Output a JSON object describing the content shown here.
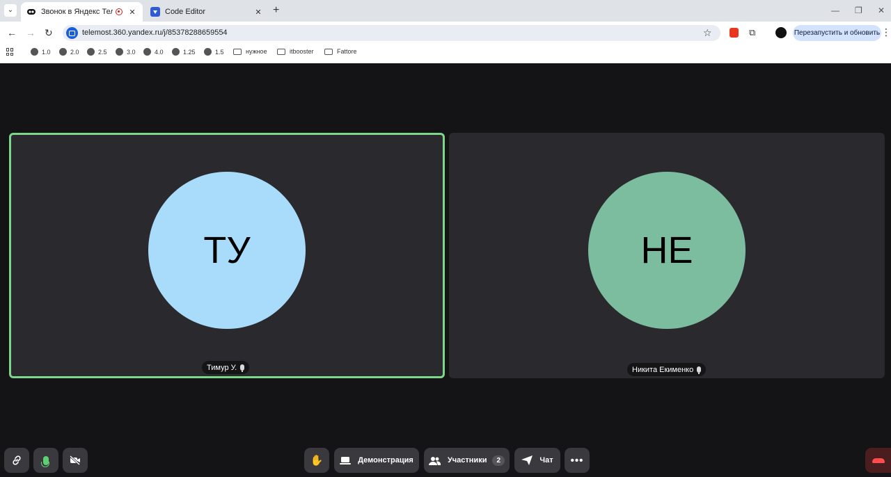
{
  "browser": {
    "tabs": [
      {
        "title": "Звонок в Яндекс Телемост",
        "close": "✕"
      },
      {
        "title": "Code Editor",
        "close": "✕"
      }
    ],
    "new_tab": "+",
    "url": "telemost.360.yandex.ru/j/85378288659554",
    "relaunch_label": "Перезапустить и обновить",
    "bookmarks": [
      "1.0",
      "2.0",
      "2.5",
      "3.0",
      "4.0",
      "1.25",
      "1.5",
      "нужное",
      "itbooster",
      "Fattore"
    ]
  },
  "call": {
    "participants": [
      {
        "initials": "ТУ",
        "name": "Тимур У.",
        "avatar_color": "#a8dcfa"
      },
      {
        "initials": "НЕ",
        "name": "Никита Екименко",
        "avatar_color": "#7cbda0"
      }
    ],
    "controls": {
      "demo_label": "Демонстрация",
      "participants_label": "Участники",
      "participants_count": "2",
      "chat_label": "Чат"
    }
  },
  "colors": {
    "active_border": "#7dd68a",
    "mic_on": "#5dd072",
    "hangup": "#ff4d4d"
  }
}
